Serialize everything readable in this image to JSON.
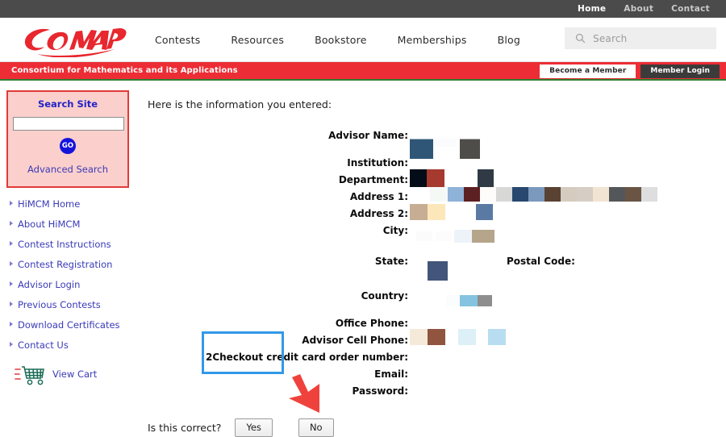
{
  "topbar": {
    "links": [
      {
        "label": "Home",
        "active": true
      },
      {
        "label": "About",
        "active": false
      },
      {
        "label": "Contact",
        "active": false
      }
    ]
  },
  "header": {
    "logo_text": "COMAP",
    "nav": [
      {
        "label": "Contests"
      },
      {
        "label": "Resources"
      },
      {
        "label": "Bookstore"
      },
      {
        "label": "Memberships"
      },
      {
        "label": "Blog"
      }
    ],
    "search": {
      "placeholder": "Search",
      "value": "",
      "icon": "search-icon"
    }
  },
  "banner": {
    "tagline": "Consortium for Mathematics and its Applications",
    "become_member": "Become a Member",
    "member_login": "Member Login",
    "bg_color": "#ed2d35",
    "underline_color": "#2f7d32"
  },
  "sidebar": {
    "search_site": {
      "title": "Search Site",
      "input_value": "",
      "input_placeholder": "",
      "go_label": "GO",
      "advanced_label": "Advanced Search",
      "border_color": "#e03a3a",
      "bg_color": "#fbcfcb",
      "title_color": "#2323c8",
      "go_color": "#1414dd"
    },
    "items": [
      {
        "label": "HiMCM Home"
      },
      {
        "label": "About HiMCM"
      },
      {
        "label": "Contest Instructions"
      },
      {
        "label": "Contest Registration"
      },
      {
        "label": "Advisor Login"
      },
      {
        "label": "Previous Contests"
      },
      {
        "label": "Download Certificates"
      },
      {
        "label": "Contact Us"
      }
    ],
    "cart": {
      "label": "View Cart",
      "icon": "shopping-cart-icon"
    },
    "link_color": "#3a3ab8"
  },
  "main": {
    "intro": "Here is the information you entered:",
    "fields": [
      {
        "label": "Advisor Name:",
        "value": ""
      },
      {
        "label": "Institution:",
        "value": ""
      },
      {
        "label": "Department:",
        "value": ""
      },
      {
        "label": "Address 1:",
        "value": ""
      },
      {
        "label": "Address 2:",
        "value": ""
      },
      {
        "label": "City:",
        "value": ""
      }
    ],
    "state_label": "State:",
    "state_value": "",
    "postal_label": "Postal Code:",
    "postal_value": "",
    "fields2": [
      {
        "label": "Country:",
        "value": ""
      },
      {
        "label": "Office Phone:",
        "value": ""
      },
      {
        "label": "Advisor Cell Phone:",
        "value": ""
      },
      {
        "label": "2Checkout credit card order number:",
        "value": ""
      },
      {
        "label": "Email:",
        "value": ""
      },
      {
        "label": "Password:",
        "value": ""
      }
    ],
    "confirm_question": "Is this correct?",
    "yes_label": "Yes",
    "no_label": "No"
  },
  "annotation": {
    "highlight_color": "#3399e8",
    "cursor_color": "#f0423c",
    "target": "Yes"
  }
}
